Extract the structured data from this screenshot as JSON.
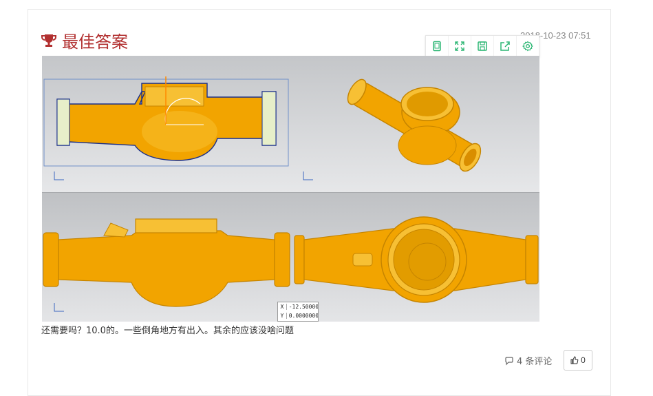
{
  "answer": {
    "title": "最佳答案",
    "timestamp": "2018-10-23 07:51",
    "text": "还需要吗？10.0的。一些倒角地方有出入。其余的应该没啥问题",
    "figure": {
      "coord_x_label": "X",
      "coord_x_value": "-12.50000",
      "coord_y_label": "Y",
      "coord_y_value": "0.0000000"
    }
  },
  "toolbar": {
    "icons": [
      "tablet-icon",
      "fullscreen-icon",
      "save-icon",
      "share-icon",
      "settings-icon"
    ],
    "accent": "#2bb673"
  },
  "footer": {
    "comments_label": "4 条评论",
    "like_count": "0"
  },
  "colors": {
    "title": "#b23030",
    "part": "#f2a400"
  }
}
